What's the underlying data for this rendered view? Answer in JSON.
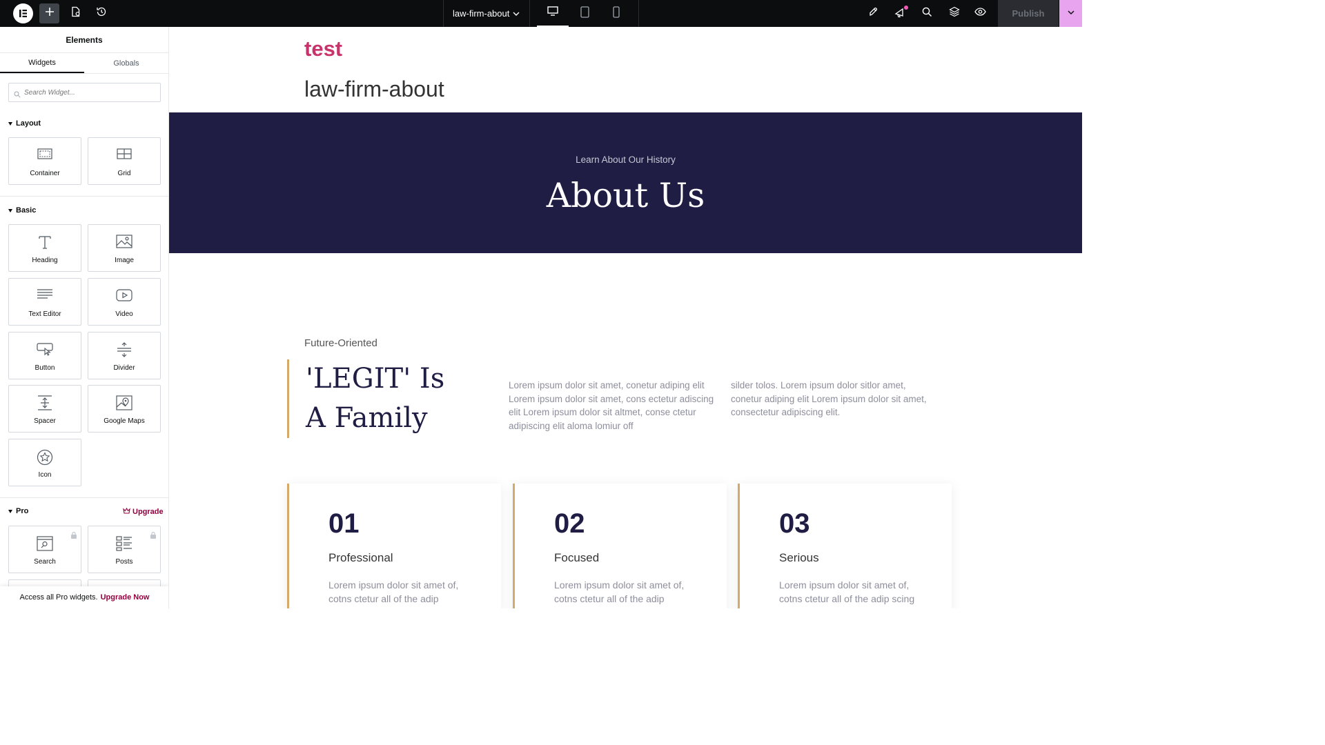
{
  "topbar": {
    "document_title": "law-firm-about",
    "publish_label": "Publish",
    "icons": [
      "elementor-logo-icon",
      "plus-icon",
      "page-settings-icon",
      "history-icon",
      "chevron-down-icon",
      "desktop-icon",
      "tablet-icon",
      "mobile-icon",
      "site-settings-icon",
      "notifications-icon",
      "search-icon",
      "structure-icon",
      "preview-eye-icon"
    ],
    "accent_color": "#e9a4f0"
  },
  "sidebar": {
    "title": "Elements",
    "tabs": [
      {
        "label": "Widgets",
        "active": true
      },
      {
        "label": "Globals",
        "active": false
      }
    ],
    "search_placeholder": "Search Widget...",
    "categories": {
      "layout": {
        "label": "Layout",
        "widgets": [
          {
            "label": "Container",
            "icon": "container-icon"
          },
          {
            "label": "Grid",
            "icon": "grid-icon"
          }
        ]
      },
      "basic": {
        "label": "Basic",
        "widgets": [
          {
            "label": "Heading",
            "icon": "heading-icon"
          },
          {
            "label": "Image",
            "icon": "image-icon"
          },
          {
            "label": "Text Editor",
            "icon": "text-editor-icon"
          },
          {
            "label": "Video",
            "icon": "video-icon"
          },
          {
            "label": "Button",
            "icon": "button-icon"
          },
          {
            "label": "Divider",
            "icon": "divider-icon"
          },
          {
            "label": "Spacer",
            "icon": "spacer-icon"
          },
          {
            "label": "Google Maps",
            "icon": "google-maps-icon"
          },
          {
            "label": "Icon",
            "icon": "star-icon"
          }
        ]
      },
      "pro": {
        "label": "Pro",
        "upgrade_label": "Upgrade",
        "widgets": [
          {
            "label": "Search",
            "icon": "search-widget-icon",
            "locked": true
          },
          {
            "label": "Posts",
            "icon": "posts-icon",
            "locked": true
          }
        ]
      }
    },
    "pro_banner": {
      "text": "Access all Pro widgets.",
      "link": "Upgrade Now"
    }
  },
  "canvas": {
    "site_title": "test",
    "page_title": "law-firm-about",
    "hero": {
      "subtitle": "Learn About Our History",
      "title": "About Us",
      "bg_color": "#1f1d43"
    },
    "intro": {
      "eyebrow": "Future-Oriented",
      "heading_line1": "'LEGIT' Is",
      "heading_line2": "A Family",
      "para1": "Lorem ipsum dolor sit amet, conetur adiping elit Lorem ipsum dolor sit amet, cons ectetur adiscing elit Lorem ipsum dolor sit altmet, conse ctetur adipiscing elit aloma lomiur off",
      "para2": "silder tolos. Lorem ipsum dolor sitlor amet, conetur adiping elit Lorem ipsum dolor sit amet, consectetur adipiscing elit."
    },
    "cards": [
      {
        "number": "01",
        "title": "Professional",
        "text": "Lorem ipsum dolor sit amet of, cotns ctetur all of the adip"
      },
      {
        "number": "02",
        "title": "Focused",
        "text": "Lorem ipsum dolor sit amet of, cotns ctetur all of the adip"
      },
      {
        "number": "03",
        "title": "Serious",
        "text": "Lorem ipsum dolor sit amet of, cotns ctetur all of the adip scing"
      }
    ],
    "gold_color": "#d4a96a"
  }
}
